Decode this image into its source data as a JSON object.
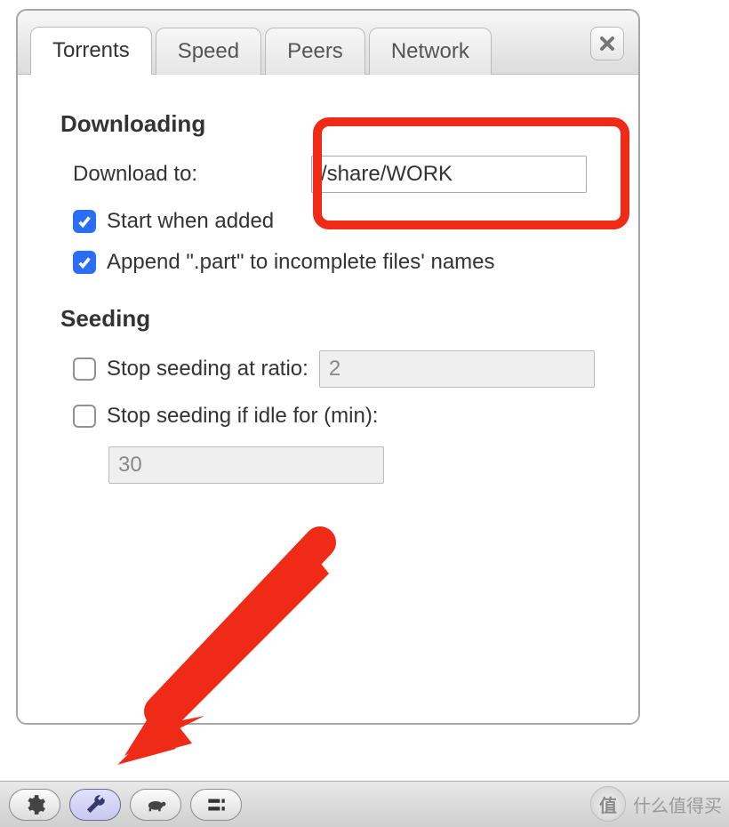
{
  "tabs": {
    "torrents": "Torrents",
    "speed": "Speed",
    "peers": "Peers",
    "network": "Network"
  },
  "downloading": {
    "heading": "Downloading",
    "download_to_label": "Download to:",
    "download_to_value": "/share/WORK",
    "start_when_added": "Start when added",
    "append_part": "Append \".part\" to incomplete files' names"
  },
  "seeding": {
    "heading": "Seeding",
    "stop_ratio_label": "Stop seeding at ratio:",
    "stop_ratio_value": "2",
    "stop_idle_label": "Stop seeding if idle for (min):",
    "stop_idle_value": "30"
  },
  "watermark": {
    "badge": "值",
    "text": "什么值得买"
  }
}
